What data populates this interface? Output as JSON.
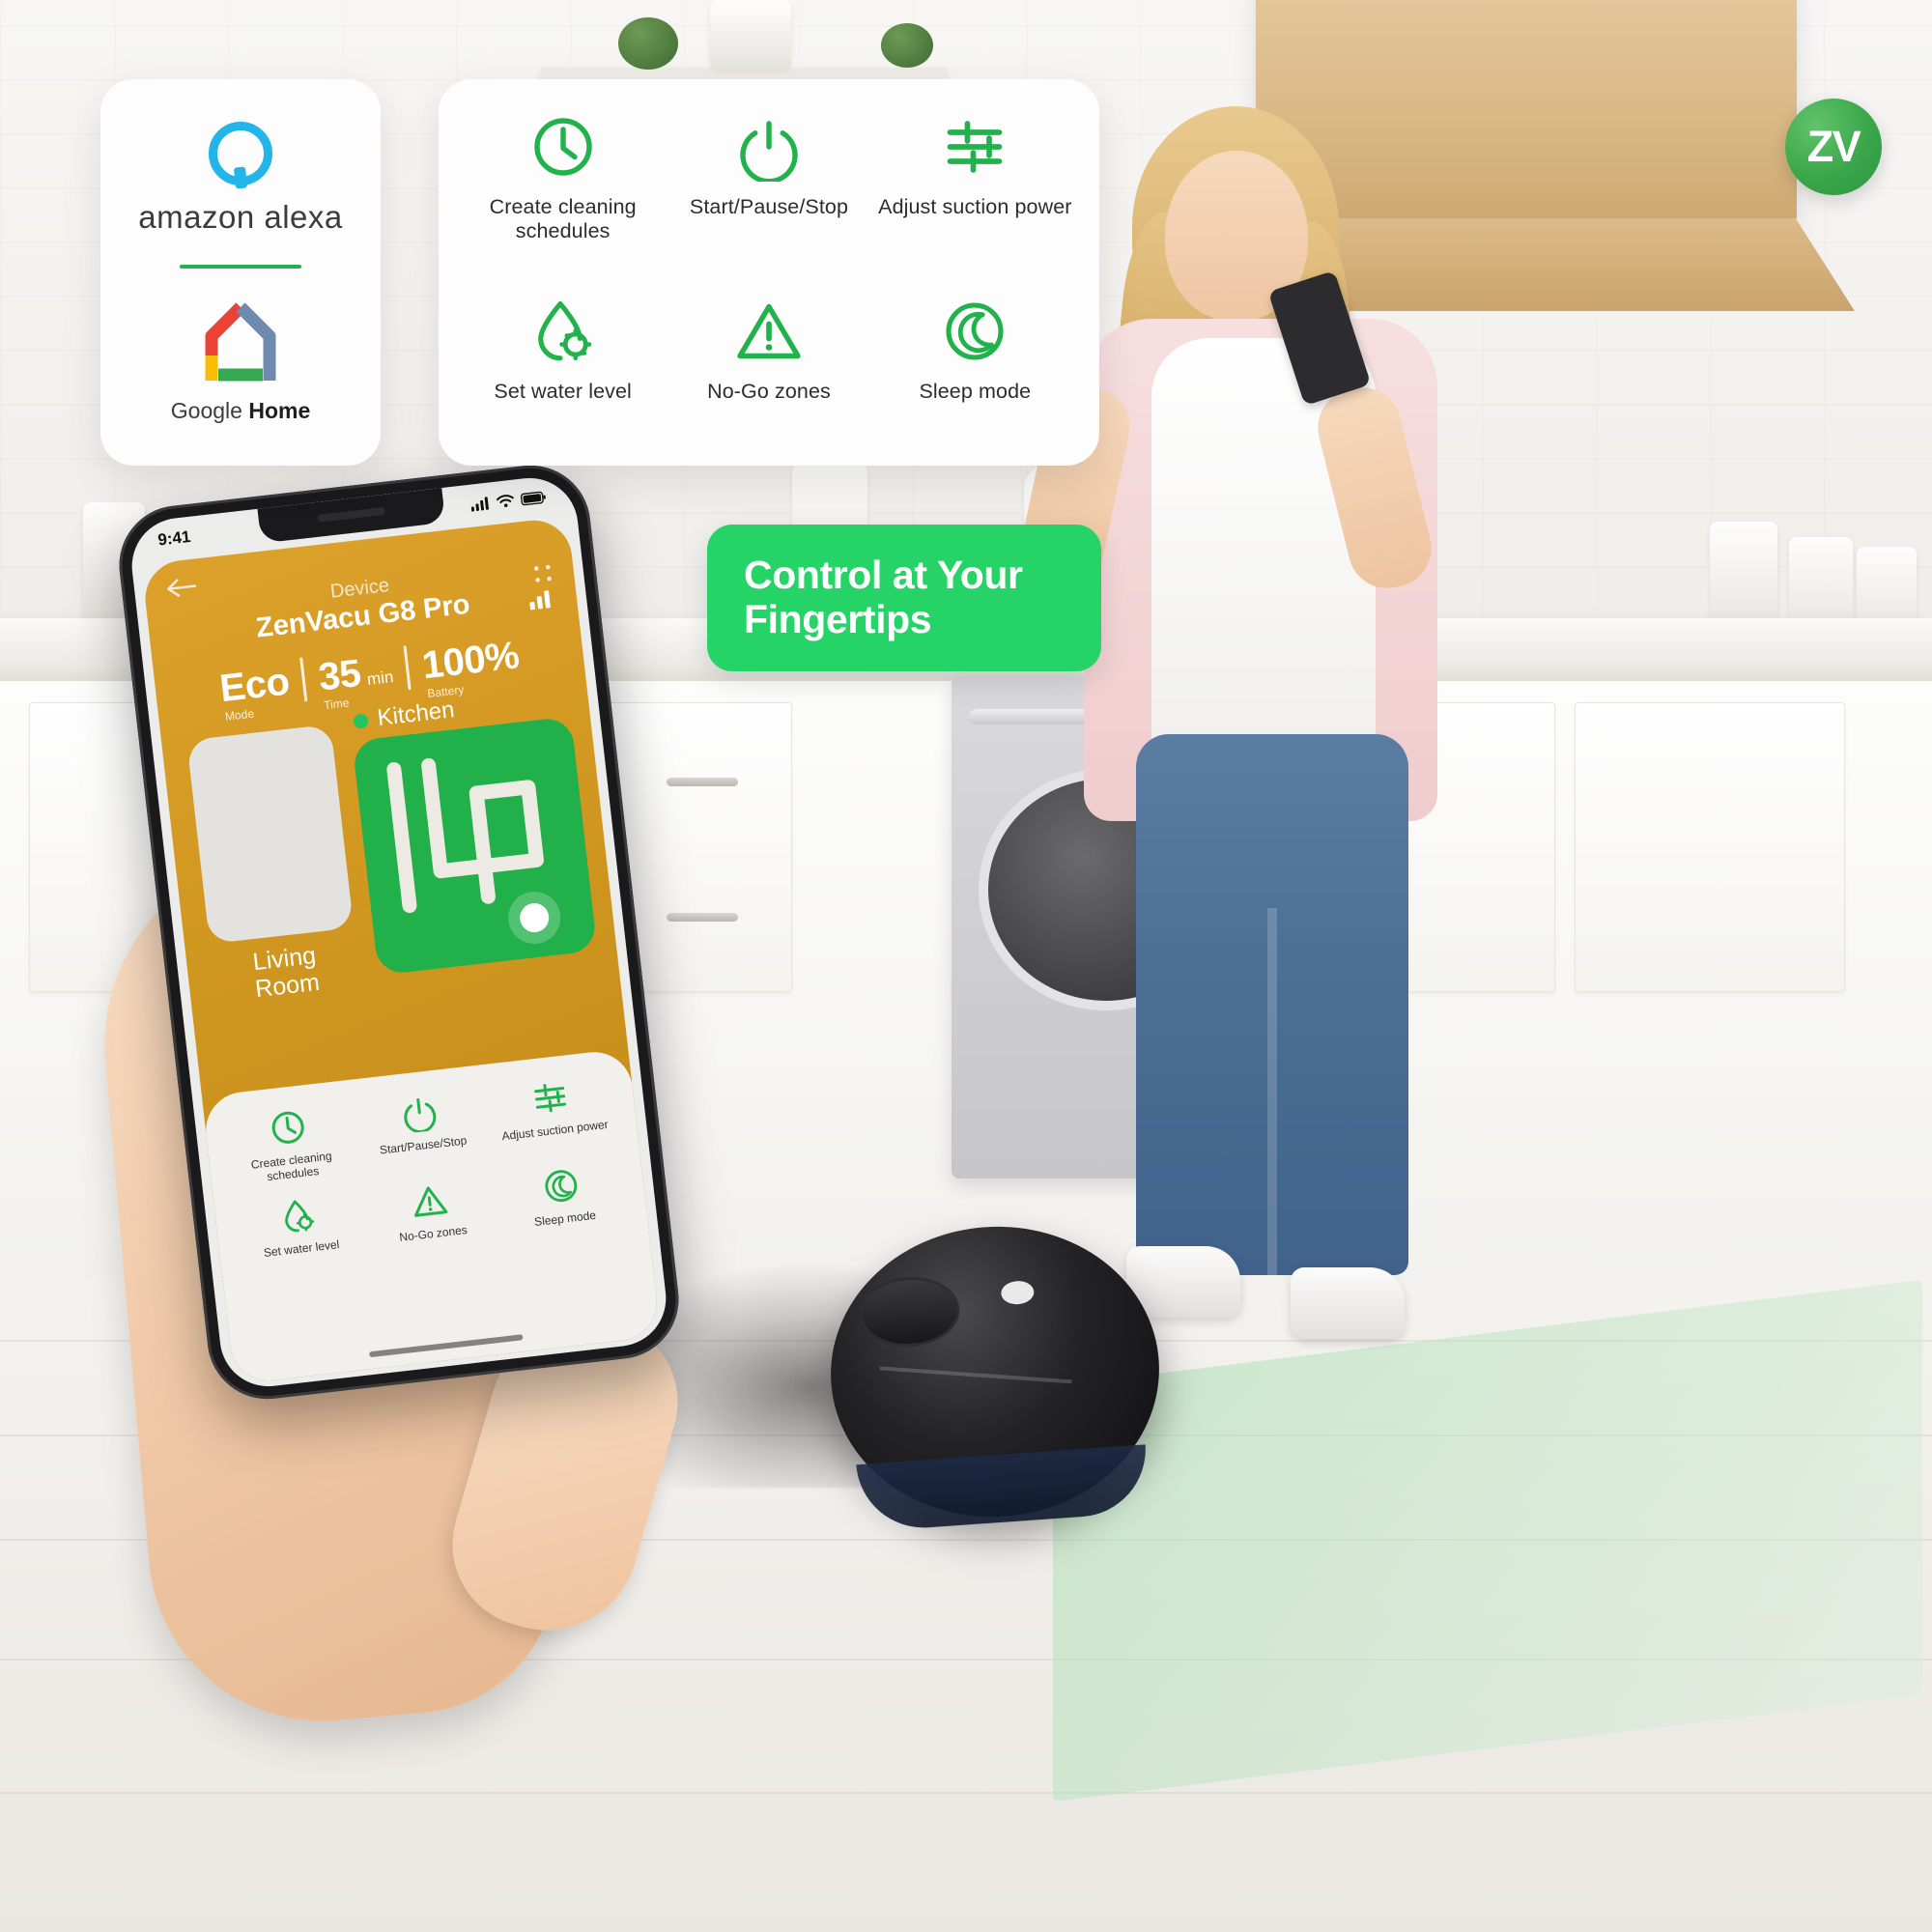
{
  "brand": {
    "badge_text": "ZV",
    "badge_color": "#3aa64a"
  },
  "colors": {
    "accent_green": "#25d366",
    "icon_green": "#22b24c",
    "app_amber": "#cf961f",
    "map_green": "#22b04a"
  },
  "integrations_card": {
    "alexa_label": "amazon alexa",
    "google_home_label_light": "Google ",
    "google_home_label_bold": "Home",
    "alexa_icon": "alexa-ring-icon",
    "google_home_icon": "google-home-house-icon"
  },
  "features_card": {
    "items": [
      {
        "icon": "clock-icon",
        "label": "Create cleaning\nschedules"
      },
      {
        "icon": "power-icon",
        "label": "Start/Pause/Stop"
      },
      {
        "icon": "sliders-icon",
        "label": "Adjust suction power"
      },
      {
        "icon": "water-drop-gear-icon",
        "label": "Set water level"
      },
      {
        "icon": "warning-triangle-icon",
        "label": "No-Go zones"
      },
      {
        "icon": "moon-circle-icon",
        "label": "Sleep mode"
      }
    ]
  },
  "banner": {
    "line1": "Control at Your",
    "line2": "Fingertips"
  },
  "phone": {
    "status_bar": {
      "time": "9:41",
      "signal_icon": "cellular-signal-icon",
      "wifi_icon": "wifi-icon",
      "battery_icon": "battery-icon"
    },
    "app": {
      "back_icon": "back-arrow-icon",
      "menu_icon": "grid-dots-icon",
      "device_label": "Device",
      "device_name": "ZenVacu G8 Pro",
      "signal_icon": "signal-bars-icon",
      "stats": [
        {
          "value": "Eco",
          "unit": "",
          "caption": "Mode"
        },
        {
          "value": "35",
          "unit": "min",
          "caption": "Time"
        },
        {
          "value": "100%",
          "unit": "",
          "caption": "Battery"
        }
      ],
      "rooms": [
        {
          "name": "Living\nRoom",
          "active": false
        },
        {
          "name": "Kitchen",
          "active": true
        }
      ],
      "panel_features": [
        {
          "icon": "clock-icon",
          "label": "Create cleaning\nschedules"
        },
        {
          "icon": "power-icon",
          "label": "Start/Pause/Stop"
        },
        {
          "icon": "sliders-icon",
          "label": "Adjust suction power"
        },
        {
          "icon": "water-drop-gear-icon",
          "label": "Set water level"
        },
        {
          "icon": "warning-triangle-icon",
          "label": "No-Go zones"
        },
        {
          "icon": "moon-circle-icon",
          "label": "Sleep mode"
        }
      ]
    }
  }
}
